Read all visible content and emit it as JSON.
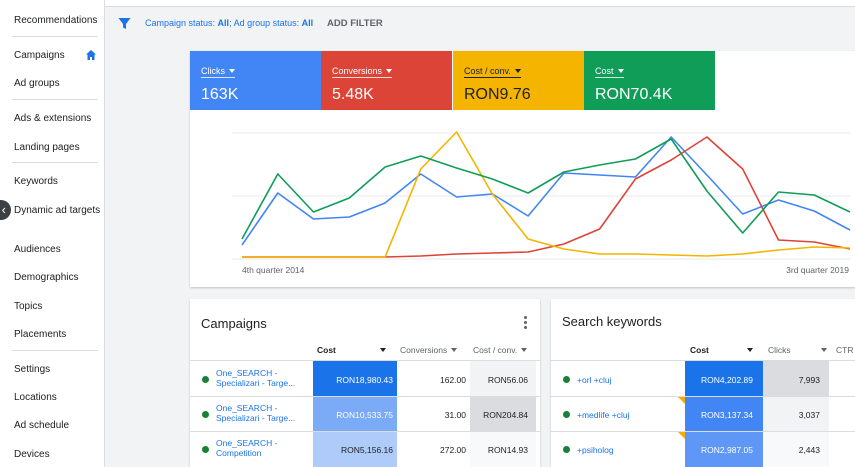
{
  "sidebar": {
    "items": [
      {
        "label": "Recommendations"
      },
      {
        "label": "Campaigns"
      },
      {
        "label": "Ad groups"
      },
      {
        "label": "Ads & extensions"
      },
      {
        "label": "Landing pages"
      },
      {
        "label": "Keywords"
      },
      {
        "label": "Dynamic ad targets"
      },
      {
        "label": "Audiences"
      },
      {
        "label": "Demographics"
      },
      {
        "label": "Topics"
      },
      {
        "label": "Placements"
      },
      {
        "label": "Settings"
      },
      {
        "label": "Locations"
      },
      {
        "label": "Ad schedule"
      },
      {
        "label": "Devices"
      }
    ]
  },
  "filter": {
    "prefix1": "Campaign status: ",
    "value1": "All",
    "prefix2": "; Ad group status: ",
    "value2": "All",
    "add_label": "ADD FILTER"
  },
  "metrics": [
    {
      "label": "Clicks",
      "value": "163K",
      "color": "#4285f4"
    },
    {
      "label": "Conversions",
      "value": "5.48K",
      "color": "#db4437"
    },
    {
      "label": "Cost / conv.",
      "value": "RON9.76",
      "color": "#f4b400"
    },
    {
      "label": "Cost",
      "value": "RON70.4K",
      "color": "#0f9d58"
    }
  ],
  "chart_data": {
    "type": "line",
    "x_start_label": "4th quarter 2014",
    "x_end_label": "3rd quarter 2019",
    "series": [
      {
        "color": "#4285f4",
        "values": [
          14,
          66,
          40,
          42,
          56,
          85,
          62,
          65,
          43,
          86,
          84,
          82,
          122,
          84,
          45,
          59,
          48,
          29
        ]
      },
      {
        "color": "#db4437",
        "values": [
          2,
          2,
          2,
          2,
          2,
          3,
          5,
          6,
          7,
          15,
          30,
          80,
          99,
          122,
          90,
          19,
          17,
          10
        ]
      },
      {
        "color": "#f4b400",
        "values": [
          2,
          2,
          2,
          2,
          2,
          90,
          127,
          65,
          20,
          10,
          5,
          5,
          4,
          3,
          5,
          9,
          12,
          11
        ]
      },
      {
        "color": "#0f9d58",
        "values": [
          20,
          85,
          47,
          61,
          92,
          103,
          91,
          80,
          66,
          87,
          94,
          100,
          120,
          68,
          26,
          67,
          64,
          47
        ]
      }
    ]
  },
  "campaigns": {
    "title": "Campaigns",
    "columns": [
      "Cost",
      "Conversions",
      "Cost / conv."
    ],
    "rows": [
      {
        "name": "One_SEARCH - Specializari - Targe...",
        "cost": "RON18,980.43",
        "conversions": "162.00",
        "cpc": "RON56.06"
      },
      {
        "name": "One_SEARCH - Specializari - Targe...",
        "cost": "RON10,533.75",
        "conversions": "31.00",
        "cpc": "RON204.84"
      },
      {
        "name": "One_SEARCH - Competition",
        "cost": "RON5,156.16",
        "conversions": "272.00",
        "cpc": "RON14.93"
      }
    ]
  },
  "keywords": {
    "title": "Search keywords",
    "columns": [
      "Cost",
      "Clicks",
      "CTR"
    ],
    "rows": [
      {
        "keyword": "+orl +cluj",
        "cost": "RON4,202.89",
        "clicks": "7,993"
      },
      {
        "keyword": "+medlife +cluj",
        "cost": "RON3,137.34",
        "clicks": "3,037"
      },
      {
        "keyword": "+psiholog",
        "cost": "RON2,987.05",
        "clicks": "2,443"
      }
    ]
  }
}
